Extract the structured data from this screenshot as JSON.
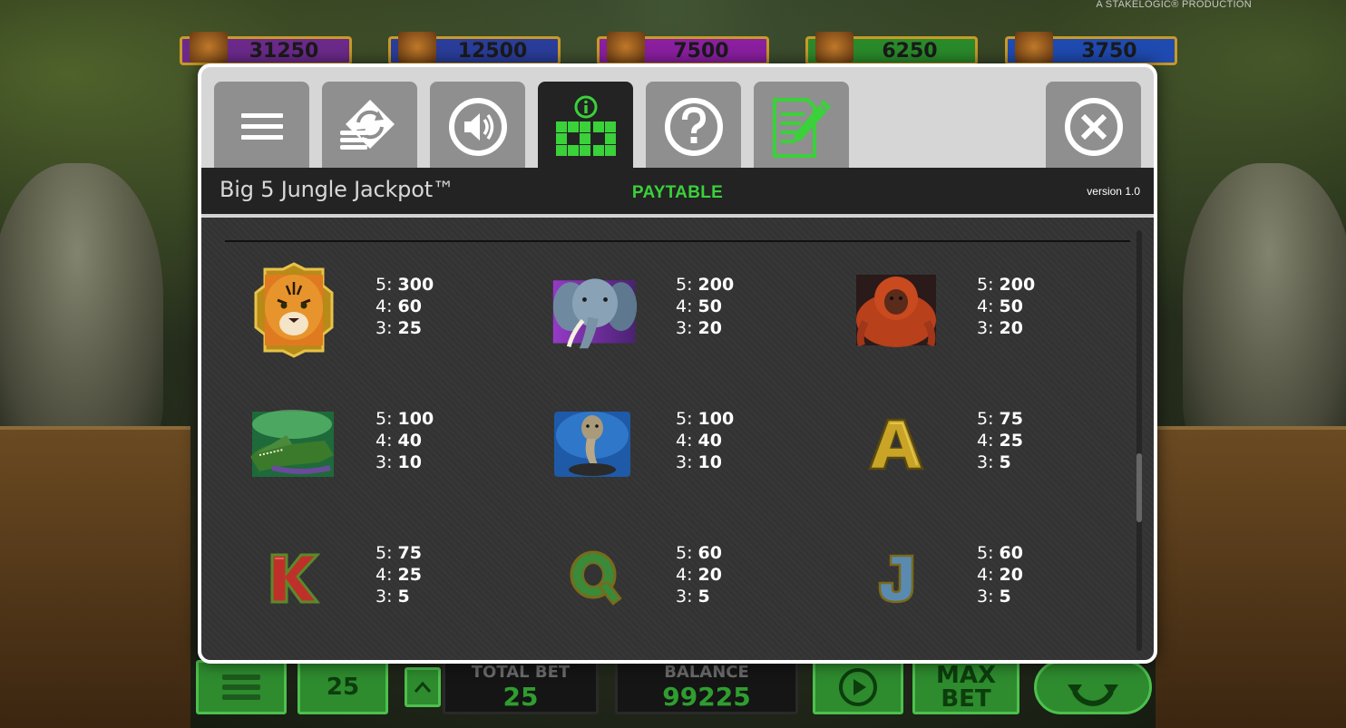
{
  "studio": "A STAKELOGIC® PRODUCTION",
  "jackpots": [
    "31250",
    "12500",
    "7500",
    "6250",
    "3750"
  ],
  "jackpot_colors": [
    "#6b2a8a",
    "#2a3d9a",
    "#8a1fa0",
    "#2a8a2a",
    "#1f4ab0"
  ],
  "controls": {
    "lines_value": "25",
    "total_bet_label": "TOTAL BET",
    "total_bet_value": "25",
    "balance_label": "BALANCE",
    "balance_value": "99225",
    "max_bet_line1": "MAX",
    "max_bet_line2": "BET"
  },
  "modal": {
    "game_title": "Big 5 Jungle Jackpot™",
    "section_title": "PAYTABLE",
    "version": "version 1.0",
    "tabs": [
      {
        "icon": "menu-icon"
      },
      {
        "icon": "autoplay-icon"
      },
      {
        "icon": "sound-icon"
      },
      {
        "icon": "paytable-icon",
        "active": true
      },
      {
        "icon": "help-icon"
      },
      {
        "icon": "history-icon"
      }
    ],
    "close_icon": "close-icon"
  },
  "paytable": [
    {
      "symbol": "tiger",
      "pays": [
        {
          "count": "5:",
          "value": "300"
        },
        {
          "count": "4:",
          "value": "60"
        },
        {
          "count": "3:",
          "value": "25"
        }
      ]
    },
    {
      "symbol": "elephant",
      "pays": [
        {
          "count": "5:",
          "value": "200"
        },
        {
          "count": "4:",
          "value": "50"
        },
        {
          "count": "3:",
          "value": "20"
        }
      ]
    },
    {
      "symbol": "orangutan",
      "pays": [
        {
          "count": "5:",
          "value": "200"
        },
        {
          "count": "4:",
          "value": "50"
        },
        {
          "count": "3:",
          "value": "20"
        }
      ]
    },
    {
      "symbol": "crocodile",
      "pays": [
        {
          "count": "5:",
          "value": "100"
        },
        {
          "count": "4:",
          "value": "40"
        },
        {
          "count": "3:",
          "value": "10"
        }
      ]
    },
    {
      "symbol": "cobra",
      "pays": [
        {
          "count": "5:",
          "value": "100"
        },
        {
          "count": "4:",
          "value": "40"
        },
        {
          "count": "3:",
          "value": "10"
        }
      ]
    },
    {
      "symbol": "A",
      "pays": [
        {
          "count": "5:",
          "value": "75"
        },
        {
          "count": "4:",
          "value": "25"
        },
        {
          "count": "3:",
          "value": "5"
        }
      ]
    },
    {
      "symbol": "K",
      "pays": [
        {
          "count": "5:",
          "value": "75"
        },
        {
          "count": "4:",
          "value": "25"
        },
        {
          "count": "3:",
          "value": "5"
        }
      ]
    },
    {
      "symbol": "Q",
      "pays": [
        {
          "count": "5:",
          "value": "60"
        },
        {
          "count": "4:",
          "value": "20"
        },
        {
          "count": "3:",
          "value": "5"
        }
      ]
    },
    {
      "symbol": "J",
      "pays": [
        {
          "count": "5:",
          "value": "60"
        },
        {
          "count": "4:",
          "value": "20"
        },
        {
          "count": "3:",
          "value": "5"
        }
      ]
    }
  ],
  "colors": {
    "accent_green": "#3ad13a",
    "tab_gray": "#8f8f8f",
    "tab_active": "#232323",
    "panel_bg": "#333333"
  }
}
